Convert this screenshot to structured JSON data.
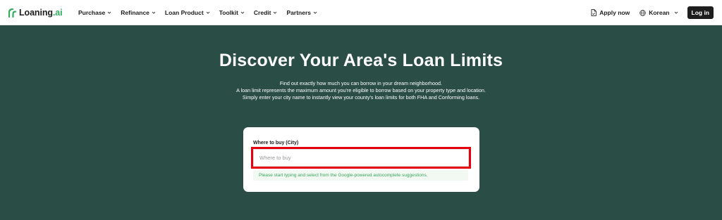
{
  "brand": {
    "name": "Loaning",
    "suffix": ".ai",
    "accent": "#2fae5b"
  },
  "nav": {
    "items": [
      {
        "label": "Purchase"
      },
      {
        "label": "Refinance"
      },
      {
        "label": "Loan Product"
      },
      {
        "label": "Toolkit"
      },
      {
        "label": "Credit"
      },
      {
        "label": "Partners"
      }
    ],
    "apply_label": "Apply now",
    "language_label": "Korean",
    "login_label": "Log in"
  },
  "hero": {
    "title": "Discover Your Area's Loan Limits",
    "lines": [
      "Find out exactly how much you can borrow in your dream neighborhood.",
      "A loan limit represents the maximum amount you're eligible to borrow based on your property type and location.",
      "Simply enter your city name to instantly view your county's loan limits for both FHA and Conforming loans."
    ]
  },
  "search": {
    "label": "Where to buy (City)",
    "placeholder": "Where to buy",
    "value": "",
    "hint": "Please start typing and select from the Google-powered autocomplete suggestions."
  },
  "colors": {
    "hero_bg": "#2a4d46",
    "highlight_border": "#e3000f",
    "hint_text": "#3aa85c"
  }
}
